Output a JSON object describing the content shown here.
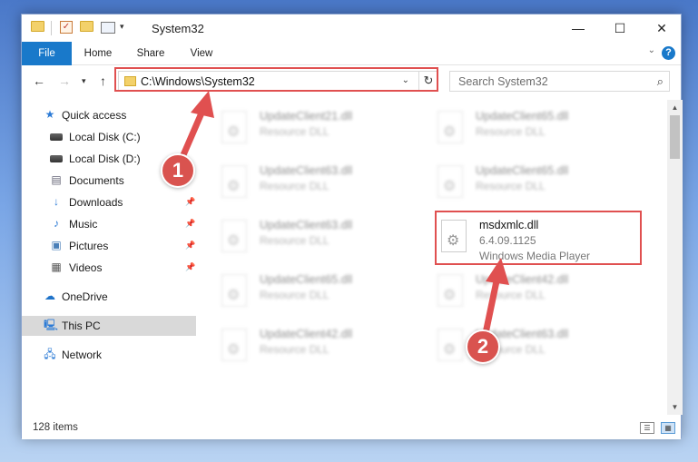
{
  "window": {
    "title": "System32"
  },
  "ribbon": {
    "tabs": [
      "File",
      "Home",
      "Share",
      "View"
    ],
    "help": "?"
  },
  "nav": {
    "address": "C:\\Windows\\System32",
    "search_placeholder": "Search System32"
  },
  "sidebar": {
    "items": [
      {
        "label": "Quick access",
        "icon": "star-icon"
      },
      {
        "label": "Local Disk (C:)",
        "icon": "drive-icon"
      },
      {
        "label": "Local Disk (D:)",
        "icon": "drive-icon"
      },
      {
        "label": "Documents",
        "icon": "documents-icon"
      },
      {
        "label": "Downloads",
        "icon": "download-icon"
      },
      {
        "label": "Music",
        "icon": "music-icon"
      },
      {
        "label": "Pictures",
        "icon": "pictures-icon"
      },
      {
        "label": "Videos",
        "icon": "videos-icon"
      },
      {
        "label": "OneDrive",
        "icon": "cloud-icon"
      },
      {
        "label": "This PC",
        "icon": "computer-icon"
      },
      {
        "label": "Network",
        "icon": "network-icon"
      }
    ]
  },
  "files": [
    {
      "name": "UpdateClient21.dll",
      "line1": "Resource DLL",
      "line2": ""
    },
    {
      "name": "UpdateClient65.dll",
      "line1": "Resource DLL",
      "line2": ""
    },
    {
      "name": "UpdateClient63.dll",
      "line1": "Resource DLL",
      "line2": ""
    },
    {
      "name": "UpdateClient65.dll",
      "line1": "Resource DLL",
      "line2": ""
    },
    {
      "name": "UpdateClient63.dll",
      "line1": "Resource DLL",
      "line2": ""
    },
    {
      "name": "msdxmlc.dll",
      "line1": "6.4.09.1125",
      "line2": "Windows Media Player"
    },
    {
      "name": "UpdateClient65.dll",
      "line1": "Resource DLL",
      "line2": ""
    },
    {
      "name": "UpdateClient42.dll",
      "line1": "Resource DLL",
      "line2": ""
    },
    {
      "name": "UpdateClient42.dll",
      "line1": "Resource DLL",
      "line2": ""
    },
    {
      "name": "UpdateClient63.dll",
      "line1": "Resource DLL",
      "line2": ""
    }
  ],
  "status": {
    "items": "128 items"
  },
  "annotations": {
    "badge1": "1",
    "badge2": "2",
    "color": "#e05050"
  }
}
